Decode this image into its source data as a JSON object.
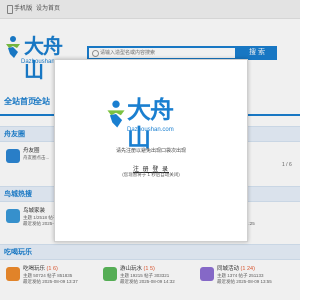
{
  "topbar": {
    "mobile": "手机版",
    "separator": "|",
    "set_home": "设为首页"
  },
  "logo": {
    "cn": "大舟山",
    "en": "Dazhoushan.com"
  },
  "search": {
    "placeholder": "请输入造型名或内容搜索",
    "button": "搜 索"
  },
  "nav": {
    "items": [
      "全站首页",
      "全站"
    ]
  },
  "sections": [
    {
      "title": "舟友圈",
      "apps": [
        {
          "name": "舟友圈",
          "l1": "舟友圈点击..."
        }
      ],
      "pager": "1 / 6"
    },
    {
      "title": "鸟城热搜",
      "apps": [
        {
          "name": "鸟城家装",
          "l1": "主题 1/2518 帖子 11955583",
          "l2": "最近发帖 2025-08-09 14:31"
        },
        {
          "name": "",
          "l1": "主题 76470 帖子 2382661",
          "l2": "最近发帖 2025-08-09 14:03"
        },
        {
          "name": "",
          "l1": "主题 5 帖子 11955583",
          "l2": "最近发帖 2025-08-09 14:25"
        }
      ]
    },
    {
      "title": "吃喝玩乐",
      "apps": [
        {
          "name": "吃喝玩乐",
          "count": "(1 6)",
          "l1": "主题 50724 帖子 851835",
          "l2": "最近发帖 2025-08-09 13:37"
        },
        {
          "name": "游山玩水",
          "count": "(1 5)",
          "l1": "主题 19215 帖子 303321",
          "l2": "最近发帖 2025-08-09 14:32"
        },
        {
          "name": "同城活动",
          "count": "(1 24)",
          "l1": "主题 1374 帖子 251133",
          "l2": "最近发帖 2025-08-09 13:55"
        }
      ]
    }
  ],
  "modal": {
    "notice": "请先注册以避免出现口袋次出现",
    "login": "注 册 登 录",
    "redirect": "(您现暂将于 1 秒后自动关闭)"
  },
  "colors": {
    "brand": "#1a7fd0",
    "accent_red": "#e4572e",
    "section_bg": "#e8f1fb"
  }
}
